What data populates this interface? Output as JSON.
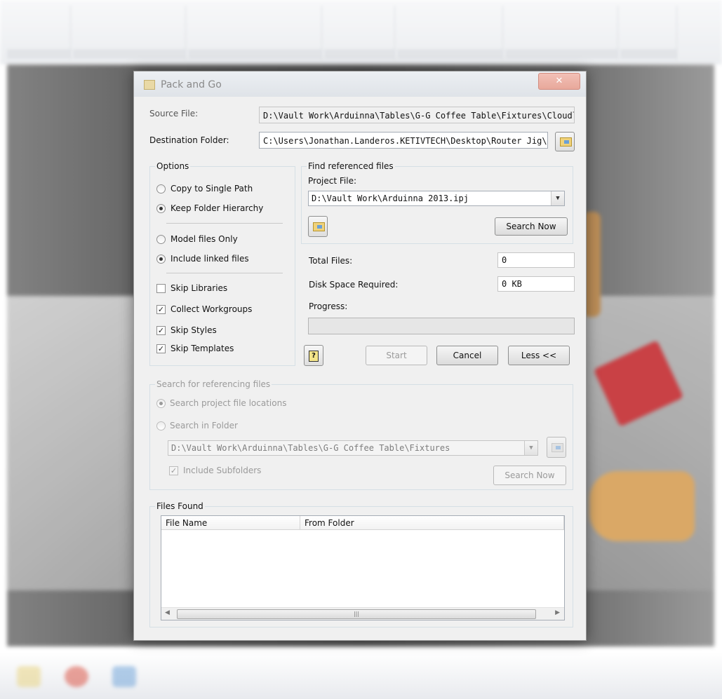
{
  "dialog": {
    "title": "Pack and Go",
    "close_label": "✕"
  },
  "source": {
    "label": "Source File:",
    "value": "D:\\Vault Work\\Arduinna\\Tables\\G-G Coffee Table\\Fixtures\\Cloudlift Fixture Ap"
  },
  "destination": {
    "label": "Destination Folder:",
    "value": "C:\\Users\\Jonathan.Landeros.KETIVTECH\\Desktop\\Router Jig\\"
  },
  "options": {
    "title": "Options",
    "copy_single_path": "Copy to Single Path",
    "keep_hierarchy": "Keep Folder Hierarchy",
    "model_only": "Model files Only",
    "include_linked": "Include linked files",
    "skip_libraries": "Skip Libraries",
    "collect_workgroups": "Collect Workgroups",
    "skip_styles": "Skip Styles",
    "skip_templates": "Skip Templates",
    "check_mark": "✓"
  },
  "find_refs": {
    "title": "Find referenced files",
    "project_label": "Project File:",
    "project_value": "D:\\Vault Work\\Arduinna 2013.ipj",
    "search_now": "Search Now"
  },
  "stats": {
    "total_files_label": "Total Files:",
    "total_files": "0",
    "disk_space_label": "Disk Space Required:",
    "disk_space": "0 KB",
    "progress_label": "Progress:",
    "progress": 0
  },
  "actions": {
    "help": "?",
    "start": "Start",
    "cancel": "Cancel",
    "less": "Less <<"
  },
  "search_referencing": {
    "title": "Search for referencing files",
    "project_locations": "Search project file locations",
    "in_folder": "Search in Folder",
    "folder_value": "D:\\Vault Work\\Arduinna\\Tables\\G-G Coffee Table\\Fixtures",
    "include_subfolders": "Include Subfolders",
    "search_now": "Search Now"
  },
  "files_found": {
    "title": "Files Found",
    "columns": [
      "File Name",
      "From Folder"
    ],
    "scroll_grip": "|||",
    "scroll_left": "◀",
    "scroll_right": "▶"
  },
  "colors": {
    "dialog_bg": "#f0f0f0",
    "close_button": "#e8a89b",
    "disabled_text": "#9a9a9a"
  }
}
